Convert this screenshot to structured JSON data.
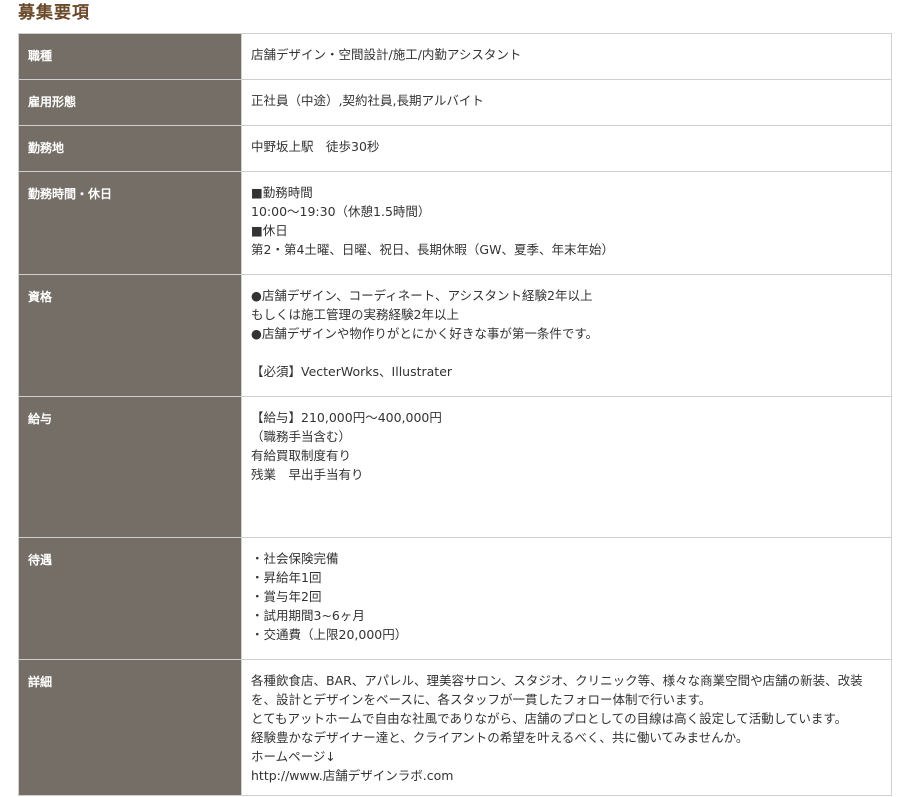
{
  "page_title": "募集要項",
  "rows": [
    {
      "label": "職種",
      "lines": [
        "店舗デザイン・空間設計/施工/内勤アシスタント"
      ]
    },
    {
      "label": "雇用形態",
      "lines": [
        "正社員（中途）,契約社員,長期アルバイト"
      ]
    },
    {
      "label": "勤務地",
      "lines": [
        "中野坂上駅　徒歩30秒"
      ]
    },
    {
      "label": "勤務時間・休日",
      "lines": [
        "■勤務時間",
        "10:00～19:30（休憩1.5時間）",
        "■休日",
        "第2・第4土曜、日曜、祝日、長期休暇（GW、夏季、年末年始）"
      ]
    },
    {
      "label": "資格",
      "lines": [
        "●店舗デザイン、コーディネート、アシスタント経験2年以上",
        "もしくは施工管理の実務経験2年以上",
        "●店舗デザインや物作りがとにかく好きな事が第一条件です。",
        "",
        "【必須】VecterWorks、Illustrater"
      ]
    },
    {
      "label": "給与",
      "lines": [
        "【給与】210,000円～400,000円",
        "（職務手当含む）",
        "有給買取制度有り",
        "残業　早出手当有り"
      ]
    },
    {
      "label": "待遇",
      "lines": [
        "・社会保険完備",
        "・昇給年1回",
        "・賞与年2回",
        "・試用期間3~6ヶ月",
        "・交通費（上限20,000円）"
      ]
    },
    {
      "label": "詳細",
      "lines": [
        "各種飲食店、BAR、アパレル、理美容サロン、スタジオ、クリニック等、様々な商業空間や店舗の新装、改装を、設計とデザインをベースに、各スタッフが一貫したフォロー体制で行います。",
        "とてもアットホームで自由な社風でありながら、店舗のプロとしての目線は高く設定して活動しています。",
        "経験豊かなデザイナー達と、クライアントの希望を叶えるべく、共に働いてみませんか。",
        "ホームページ↓",
        "http://www.店舗デザインラボ.com"
      ]
    }
  ]
}
